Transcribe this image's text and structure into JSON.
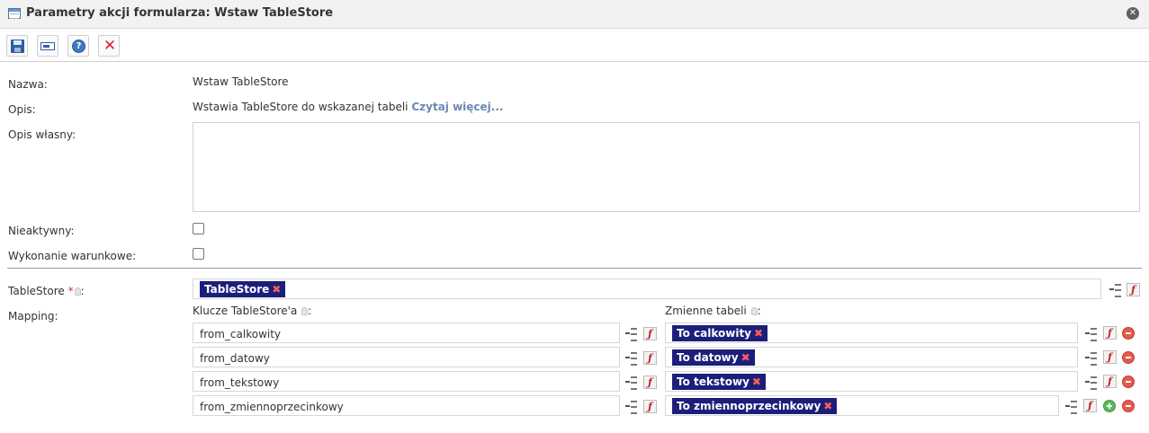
{
  "window": {
    "title": "Parametry akcji formularza: Wstaw TableStore",
    "close_glyph": "✕"
  },
  "toolbar": {
    "save_icon": "save-icon",
    "field_icon": "field-icon",
    "help_glyph": "?",
    "cancel_glyph": "✕"
  },
  "form": {
    "name_label": "Nazwa:",
    "name_value": "Wstaw TableStore",
    "desc_label": "Opis:",
    "desc_value": "Wstawia TableStore do wskazanej tabeli",
    "read_more": "Czytaj więcej...",
    "custom_desc_label": "Opis własny:",
    "custom_desc_value": "",
    "inactive_label": "Nieaktywny:",
    "inactive_checked": false,
    "conditional_label": "Wykonanie warunkowe:",
    "conditional_checked": false
  },
  "tablestore": {
    "label": "TableStore",
    "required_mark": "*",
    "colon": ":",
    "tag": "TableStore",
    "tag_remove": "✖"
  },
  "mapping": {
    "label": "Mapping:",
    "keys_header": "Klucze TableStore'a",
    "vars_header": "Zmienne tabeli",
    "colon": ":",
    "fx_glyph": "ƒ",
    "tag_remove": "✖",
    "rows": [
      {
        "key": "from_calkowity",
        "var": "To calkowity"
      },
      {
        "key": "from_datowy",
        "var": "To datowy"
      },
      {
        "key": "from_tekstowy",
        "var": "To tekstowy"
      },
      {
        "key": "from_zmiennoprzecinkowy",
        "var": "To zmiennoprzecinkowy"
      }
    ]
  }
}
